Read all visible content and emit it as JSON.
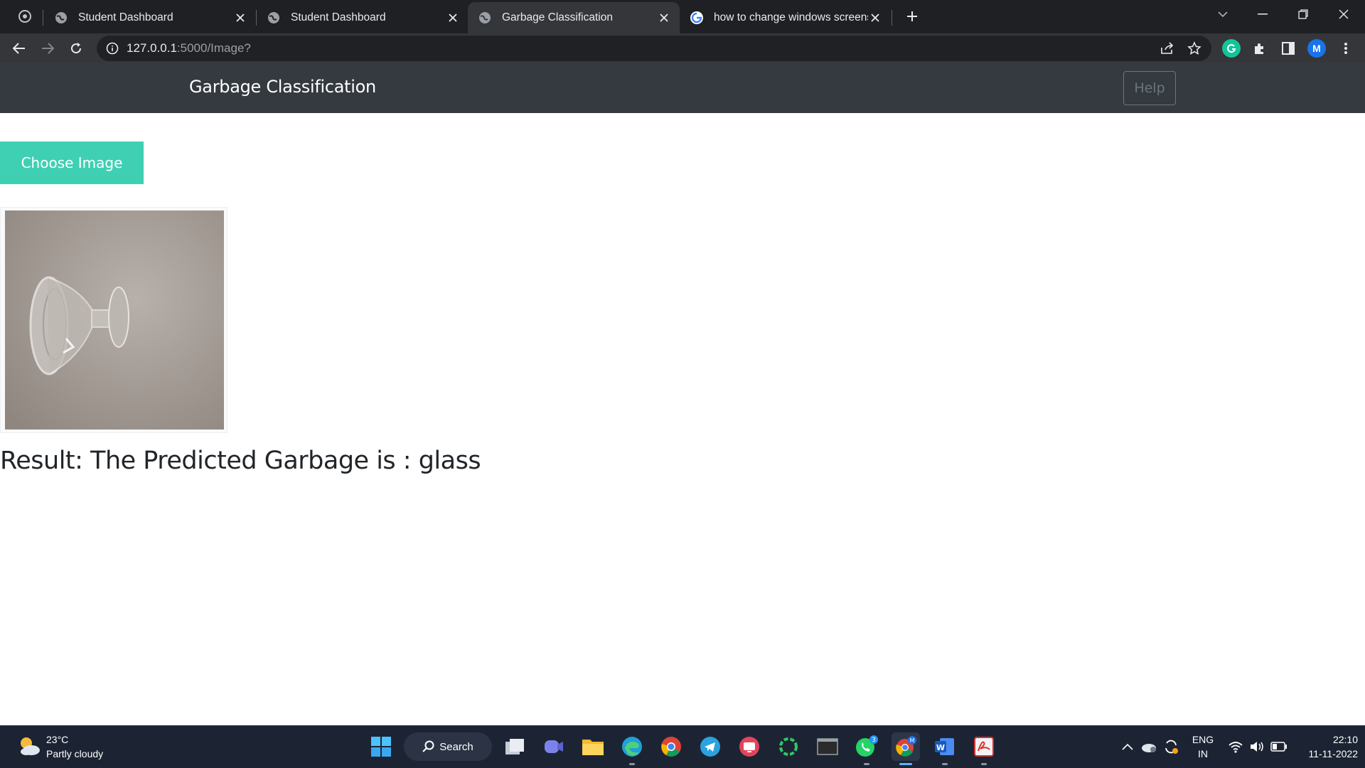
{
  "browser": {
    "tabs": [
      {
        "title": "Student Dashboard",
        "active": false
      },
      {
        "title": "Student Dashboard",
        "active": false
      },
      {
        "title": "Garbage Classification",
        "active": true
      },
      {
        "title": "how to change windows screens",
        "active": false
      }
    ],
    "url_host": "127.0.0.1",
    "url_path": ":5000/Image?",
    "profile_initial": "M"
  },
  "app": {
    "title": "Garbage Classification",
    "help_label": "Help",
    "choose_label": "Choose Image",
    "result_text": "Result: The Predicted Garbage is : glass"
  },
  "taskbar": {
    "weather_temp": "23°C",
    "weather_condition": "Partly cloudy",
    "search_label": "Search",
    "whatsapp_badge": "3",
    "lang_line1": "ENG",
    "lang_line2": "IN",
    "time": "22:10",
    "date": "11-11-2022"
  },
  "colors": {
    "header_bg": "#343a40",
    "choose_button": "#3fd0b3",
    "taskbar_bg": "#1c2434"
  }
}
